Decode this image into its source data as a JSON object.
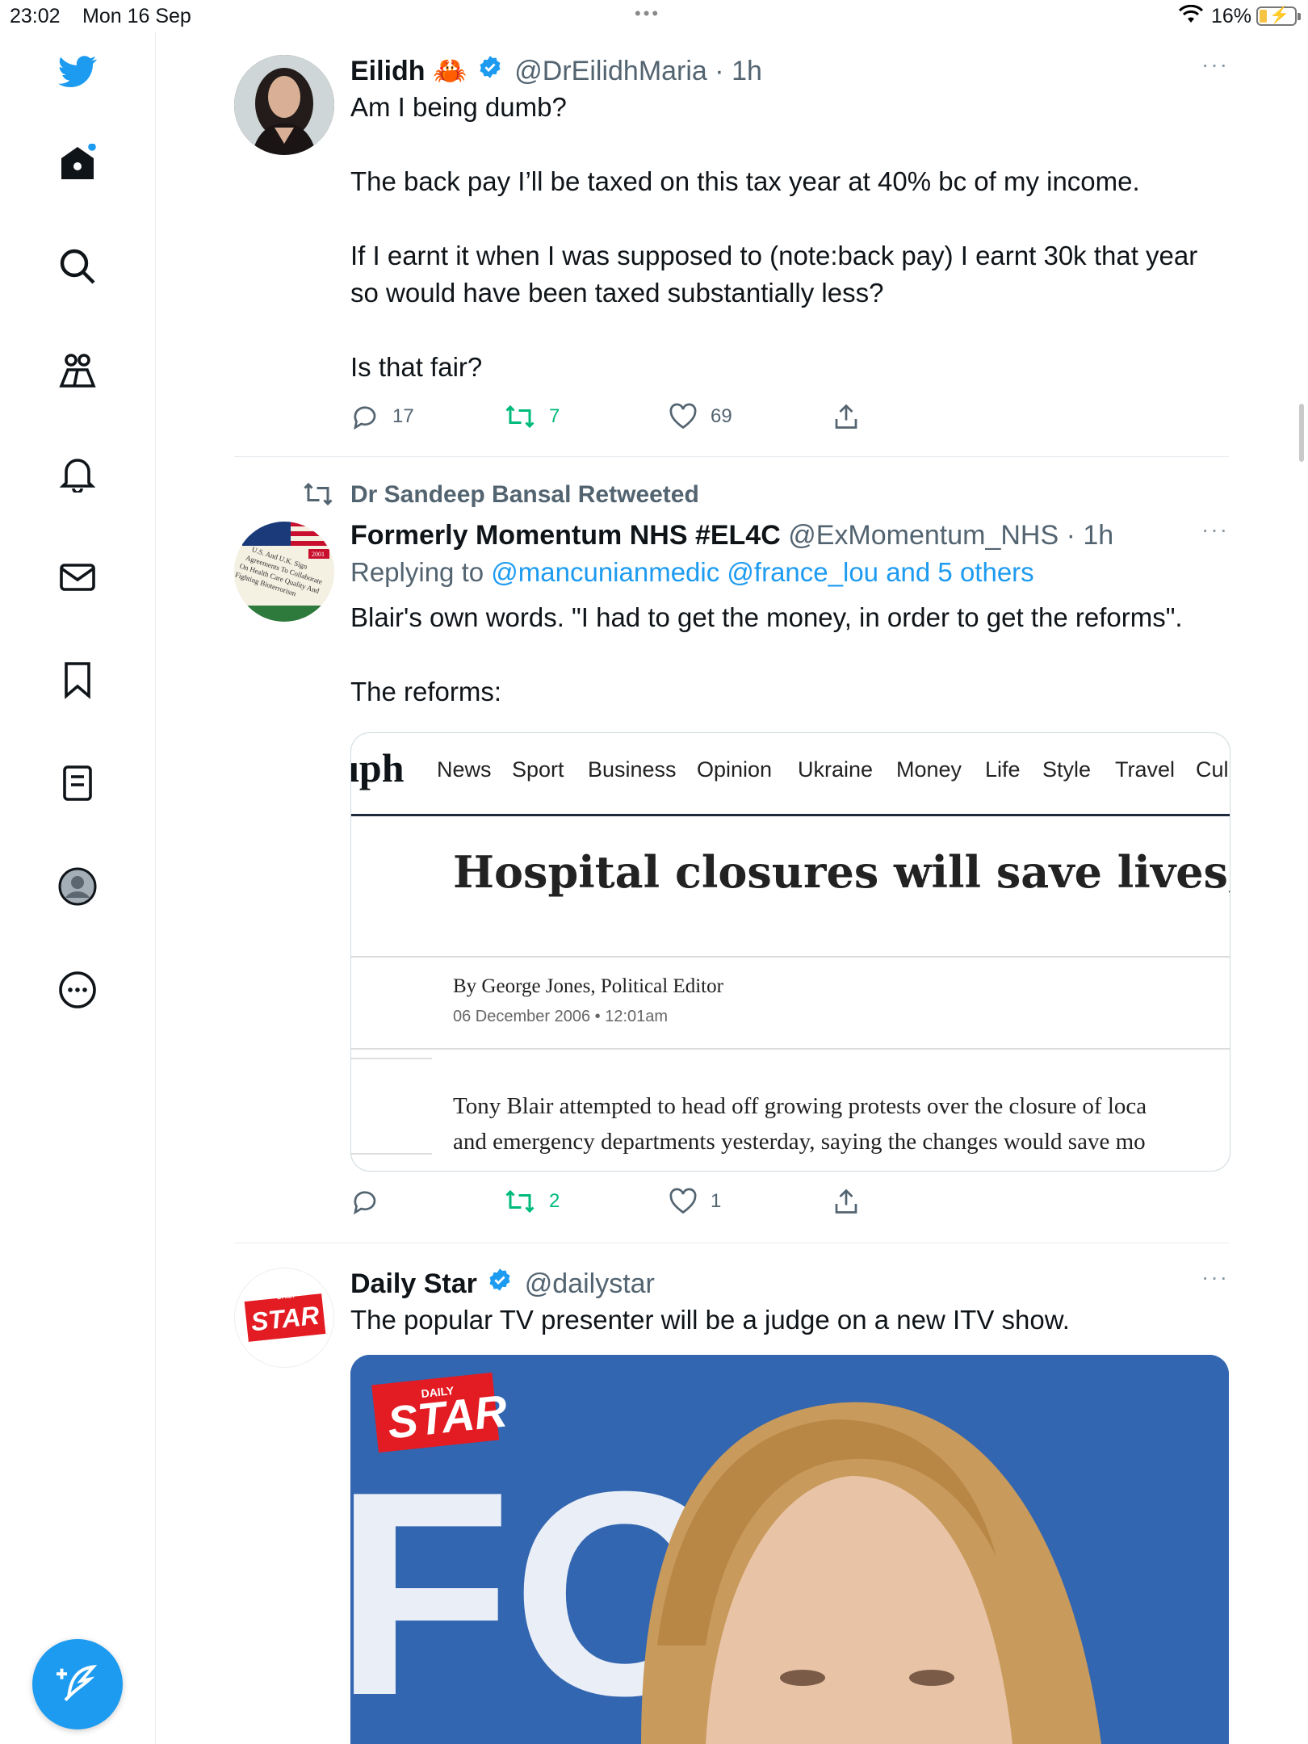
{
  "status_bar": {
    "time": "23:02",
    "date": "Mon 16 Sep",
    "battery": "16%"
  },
  "sidebar": {
    "items": [
      {
        "icon": "twitter-bird-icon"
      },
      {
        "icon": "home-icon"
      },
      {
        "icon": "search-icon"
      },
      {
        "icon": "communities-icon"
      },
      {
        "icon": "bell-icon"
      },
      {
        "icon": "mail-icon"
      },
      {
        "icon": "bookmark-icon"
      },
      {
        "icon": "lists-icon"
      },
      {
        "icon": "profile-icon"
      },
      {
        "icon": "more-icon"
      }
    ],
    "compose_icon": "compose-icon"
  },
  "tweets": [
    {
      "name": "Eilidh",
      "emoji": "🦀",
      "handle": "@DrEilidhMaria",
      "time": "· 1h",
      "paragraphs": [
        "Am I being dumb?",
        "The back pay I’ll be taxed on this tax year at 40% bc of my income.",
        "If I earnt it when I was supposed to (note:back pay) I earnt 30k that year so would have been taxed substantially less?",
        "Is that fair?"
      ],
      "replies": "17",
      "retweets": "7",
      "likes": "69"
    },
    {
      "retweeted_by": "Dr Sandeep Bansal Retweeted",
      "name": "Formerly Momentum NHS #EL4C",
      "handle": "@ExMomentum_NHS",
      "time": "· 1h",
      "replying_prefix": "Replying to",
      "replying_to": "@mancunianmedic @france_lou and 5 others",
      "paragraphs": [
        "Blair's own words. \"I had to get the money, in order to get the reforms\".",
        "The reforms:"
      ],
      "card": {
        "logo": "ıph",
        "nav": [
          "News",
          "Sport",
          "Business",
          "Opinion",
          "Ukraine",
          "Money",
          "Life",
          "Style",
          "Travel",
          "Cul"
        ],
        "headline": "Hospital closures will save lives, says B",
        "byline": "By George Jones, Political Editor",
        "date": "06 December 2006 • 12:01am",
        "para_line1": "Tony Blair attempted to head off growing protests over the closure of loca",
        "para_line2": "and emergency departments yesterday, saying the changes would save mo"
      },
      "replies": "",
      "retweets": "2",
      "likes": "1"
    },
    {
      "name": "Daily Star",
      "handle": "@dailystar",
      "text": "The popular TV presenter will be a judge on a new ITV show.",
      "avatar_text": "STAR",
      "avatar_small": "DAILY"
    }
  ],
  "colors": {
    "accent": "#1d9bf0",
    "retweet": "#00ba7c",
    "muted": "#536471"
  }
}
